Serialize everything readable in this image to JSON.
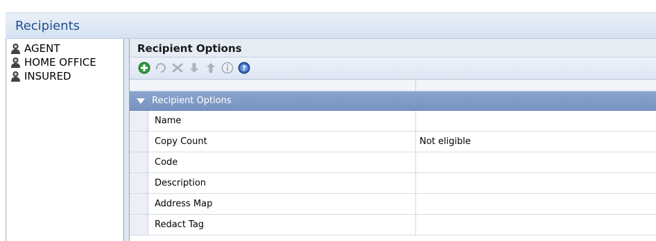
{
  "panel": {
    "title": "Recipients"
  },
  "recipients": {
    "items": [
      {
        "label": "AGENT",
        "icon": "person-icon"
      },
      {
        "label": "HOME OFFICE",
        "icon": "person-icon"
      },
      {
        "label": "INSURED",
        "icon": "person-icon"
      }
    ]
  },
  "options": {
    "title": "Recipient Options",
    "toolbar": [
      "add-icon",
      "refresh-icon",
      "delete-icon",
      "move-down-icon",
      "move-up-icon",
      "info-icon",
      "help-icon"
    ],
    "category": "Recipient Options",
    "rows": [
      {
        "name": "Name",
        "value": ""
      },
      {
        "name": "Copy Count",
        "value": "Not eligible"
      },
      {
        "name": "Code",
        "value": ""
      },
      {
        "name": "Description",
        "value": ""
      },
      {
        "name": "Address Map",
        "value": ""
      },
      {
        "name": "Redact Tag",
        "value": ""
      }
    ]
  },
  "colors": {
    "header_title": "#1f4e8c",
    "category_bar": "#7f99c6",
    "add_green": "#2f9a3a",
    "help_blue": "#2d5fb7"
  }
}
